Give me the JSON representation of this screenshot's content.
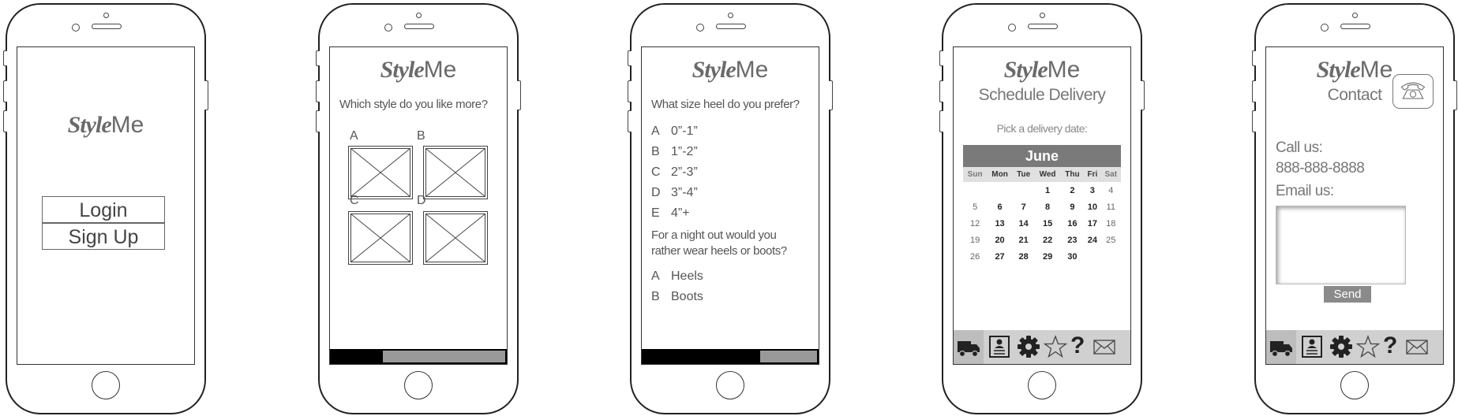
{
  "brand": {
    "script": "Style",
    "suffix": "Me"
  },
  "screens": {
    "login": {
      "login_label": "Login",
      "signup_label": "Sign Up"
    },
    "style_quiz": {
      "question": "Which style do you like more?",
      "options": [
        "A",
        "B",
        "C",
        "D"
      ],
      "progress": 0.3
    },
    "heel_quiz": {
      "question1": "What size heel do you prefer?",
      "heel_options": [
        {
          "key": "A",
          "label": "0”-1”"
        },
        {
          "key": "B",
          "label": "1”-2”"
        },
        {
          "key": "C",
          "label": "2”-3”"
        },
        {
          "key": "D",
          "label": "3”-4”"
        },
        {
          "key": "E",
          "label": "4”+"
        }
      ],
      "question2_line1": "For a night out would you",
      "question2_line2": "rather wear heels or boots?",
      "footwear_options": [
        {
          "key": "A",
          "label": "Heels"
        },
        {
          "key": "B",
          "label": "Boots"
        }
      ],
      "progress": 0.67
    },
    "schedule": {
      "title": "Schedule Delivery",
      "prompt": "Pick a delivery date:",
      "month": "June",
      "weekdays": [
        "Sun",
        "Mon",
        "Tue",
        "Wed",
        "Thu",
        "Fri",
        "Sat"
      ],
      "weeks": [
        [
          "",
          "",
          "",
          "1",
          "2",
          "3",
          "4"
        ],
        [
          "5",
          "6",
          "7",
          "8",
          "9",
          "10",
          "11"
        ],
        [
          "12",
          "13",
          "14",
          "15",
          "16",
          "17",
          "18"
        ],
        [
          "19",
          "20",
          "21",
          "22",
          "23",
          "24",
          "25"
        ],
        [
          "26",
          "27",
          "28",
          "29",
          "30",
          "",
          ""
        ]
      ]
    },
    "contact": {
      "title": "Contact",
      "call_label": "Call us:",
      "phone_number": "888-888-8888",
      "email_label": "Email us:",
      "send_label": "Send"
    }
  },
  "tabbar": {
    "icons": [
      "truck-icon",
      "profile-card-icon",
      "gear-icon",
      "star-icon",
      "help-icon",
      "mail-icon"
    ],
    "help_glyph": "?"
  }
}
